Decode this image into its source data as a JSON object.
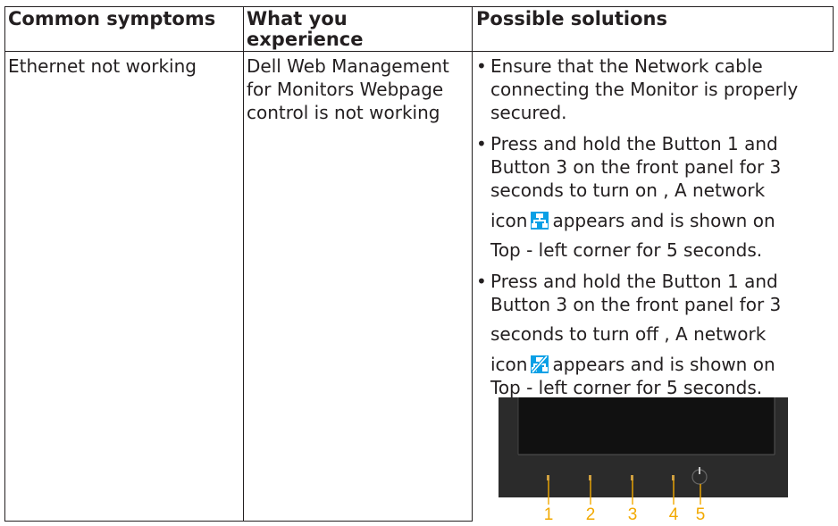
{
  "header": {
    "col1": "Common symptoms",
    "col2_line1": "What you",
    "col2_line2": "experience",
    "col3": "Possible solutions"
  },
  "row": {
    "symptom": "Ethernet not working",
    "experience_lines": [
      "Dell Web Management",
      "for Monitors Webpage",
      "control is not working"
    ],
    "solutions": [
      {
        "bullet": "•",
        "lines": [
          "Ensure that the Network cable",
          "connecting the Monitor is properly",
          "secured."
        ]
      },
      {
        "bullet": "•",
        "line1": "Press and hold the Button 1 and",
        "line2": "Button 3 on the front panel for 3",
        "line3": "seconds to turn on , A network",
        "line4_before": "icon",
        "line4_after": "appears and is shown on",
        "line5": "Top - left corner for 5 seconds.",
        "icon": "network-on-icon"
      },
      {
        "bullet": "•",
        "line1": "Press and hold the Button 1 and",
        "line2": "Button 3 on the front panel for 3",
        "line3": "seconds to turn off , A network",
        "line4_before": "icon",
        "line4_after": "appears and is shown on",
        "line5": "Top - left corner for 5 seconds.",
        "icon": "network-off-icon"
      }
    ]
  },
  "monitor_panel": {
    "button_numbers": [
      "1",
      "2",
      "3",
      "4",
      "5"
    ],
    "label_color": "#f2a900",
    "icon_color": "#0aa0e6"
  }
}
